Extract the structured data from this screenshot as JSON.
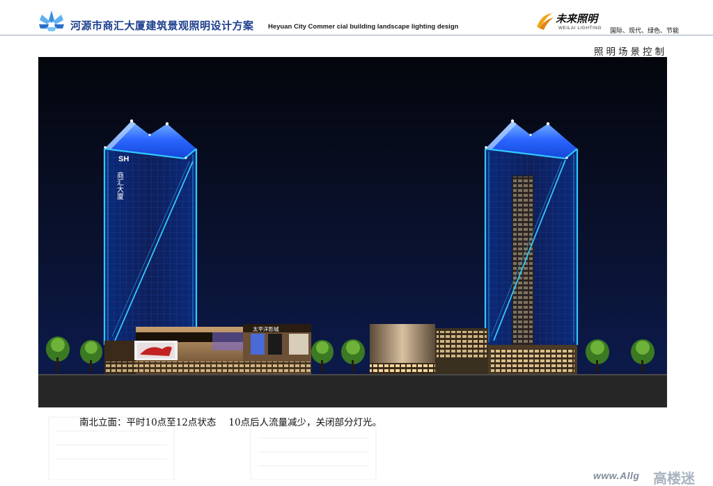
{
  "header": {
    "title_cn": "河源市商汇大厦建筑景观照明设计方案",
    "title_en": "Heyuan City Commer cial building landscape lighting design",
    "brand_cn": "未来照明",
    "brand_en": "WEILAI LIGHTING",
    "slogan": "国际、现代、绿色、节能"
  },
  "section": {
    "title": "照明场景控制"
  },
  "rendering": {
    "tower_sign_sh": "SH",
    "tower_sign_cn": "商汇大厦",
    "cinema_sign": "太平洋影城"
  },
  "caption": {
    "part1": "南北立面：平时10点至12点状态",
    "part2": "10点后人流量减少，关闭部分灯光。"
  },
  "watermark": {
    "text_en": "www.Allg",
    "text_cn": "高楼迷"
  },
  "colors": {
    "title_blue": "#1d3f8d",
    "night_sky": "#05070f",
    "tower_cyan": "#33c8ff",
    "roof_blue": "#1c5cff"
  }
}
